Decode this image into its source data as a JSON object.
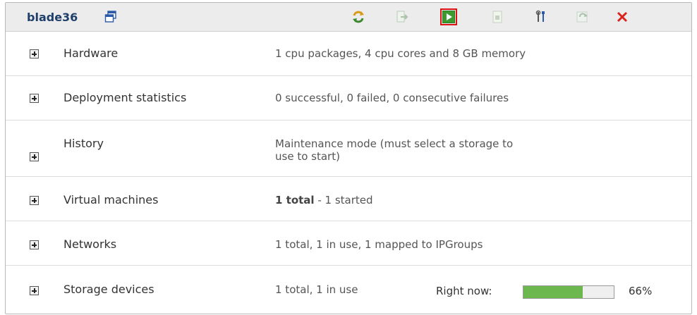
{
  "header": {
    "title": "blade36",
    "toolbar": [
      {
        "icon": "refresh-icon",
        "selected": false
      },
      {
        "icon": "migrate-icon",
        "selected": false
      },
      {
        "icon": "start-icon",
        "selected": true
      },
      {
        "icon": "stop-icon",
        "selected": false
      },
      {
        "icon": "tools-icon",
        "selected": false
      },
      {
        "icon": "sync-icon",
        "selected": false
      },
      {
        "icon": "delete-icon",
        "selected": false
      }
    ]
  },
  "rows": [
    {
      "label": "Hardware",
      "value": "1 cpu packages, 4 cpu cores and 8 GB memory"
    },
    {
      "label": "Deployment statistics",
      "value": "0 successful, 0 failed, 0 consecutive failures"
    },
    {
      "label": "History",
      "value_line1": "Maintenance mode (must select a storage to",
      "value_line2": "use to start)"
    },
    {
      "label": "Virtual machines",
      "value_bold": "1 total",
      "value_rest": " - 1 started"
    },
    {
      "label": "Networks",
      "value": "1 total, 1 in use, 1 mapped to IPGroups"
    },
    {
      "label": "Storage devices",
      "value": "1 total, 1 in use",
      "right_now_label": "Right now:",
      "usage_percent": 66,
      "usage_text": "66%"
    }
  ],
  "colors": {
    "accent": "#1f3f6a",
    "progress": "#6cb84f",
    "selected_border": "#dd1111",
    "delete": "#d9261c"
  }
}
